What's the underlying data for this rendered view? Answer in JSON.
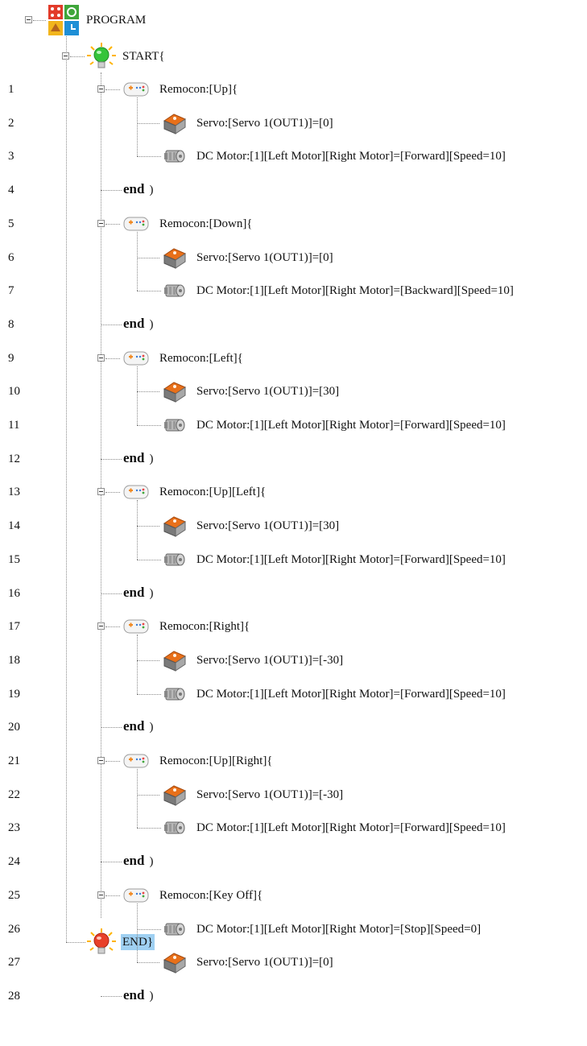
{
  "program_label": "PROGRAM",
  "start_label": "START{",
  "end_label": "END}",
  "end_keyword": "end",
  "end_suffix": ")",
  "nodes": [
    {
      "line": "1",
      "kind": "remocon",
      "text": "Remocon:[Up]{"
    },
    {
      "line": "2",
      "kind": "servo",
      "text": "Servo:[Servo 1(OUT1)]=[0]"
    },
    {
      "line": "3",
      "kind": "motor",
      "text": "DC Motor:[1][Left Motor][Right Motor]=[Forward][Speed=10]"
    },
    {
      "line": "4",
      "kind": "end"
    },
    {
      "line": "5",
      "kind": "remocon",
      "text": "Remocon:[Down]{"
    },
    {
      "line": "6",
      "kind": "servo",
      "text": "Servo:[Servo 1(OUT1)]=[0]"
    },
    {
      "line": "7",
      "kind": "motor",
      "text": "DC Motor:[1][Left Motor][Right Motor]=[Backward][Speed=10]"
    },
    {
      "line": "8",
      "kind": "end"
    },
    {
      "line": "9",
      "kind": "remocon",
      "text": "Remocon:[Left]{"
    },
    {
      "line": "10",
      "kind": "servo",
      "text": "Servo:[Servo 1(OUT1)]=[30]"
    },
    {
      "line": "11",
      "kind": "motor",
      "text": "DC Motor:[1][Left Motor][Right Motor]=[Forward][Speed=10]"
    },
    {
      "line": "12",
      "kind": "end"
    },
    {
      "line": "13",
      "kind": "remocon",
      "text": "Remocon:[Up][Left]{"
    },
    {
      "line": "14",
      "kind": "servo",
      "text": "Servo:[Servo 1(OUT1)]=[30]"
    },
    {
      "line": "15",
      "kind": "motor",
      "text": "DC Motor:[1][Left Motor][Right Motor]=[Forward][Speed=10]"
    },
    {
      "line": "16",
      "kind": "end"
    },
    {
      "line": "17",
      "kind": "remocon",
      "text": "Remocon:[Right]{"
    },
    {
      "line": "18",
      "kind": "servo",
      "text": "Servo:[Servo 1(OUT1)]=[-30]"
    },
    {
      "line": "19",
      "kind": "motor",
      "text": "DC Motor:[1][Left Motor][Right Motor]=[Forward][Speed=10]"
    },
    {
      "line": "20",
      "kind": "end"
    },
    {
      "line": "21",
      "kind": "remocon",
      "text": "Remocon:[Up][Right]{"
    },
    {
      "line": "22",
      "kind": "servo",
      "text": "Servo:[Servo 1(OUT1)]=[-30]"
    },
    {
      "line": "23",
      "kind": "motor",
      "text": "DC Motor:[1][Left Motor][Right Motor]=[Forward][Speed=10]"
    },
    {
      "line": "24",
      "kind": "end"
    },
    {
      "line": "25",
      "kind": "remocon",
      "text": "Remocon:[Key Off]{"
    },
    {
      "line": "26",
      "kind": "motor",
      "text": "DC Motor:[1][Left Motor][Right Motor]=[Stop][Speed=0]"
    },
    {
      "line": "27",
      "kind": "servo",
      "text": "Servo:[Servo 1(OUT1)]=[0]"
    },
    {
      "line": "28",
      "kind": "end"
    }
  ],
  "colors": {
    "selection": "#9fd0f2",
    "tree_line": "#8a8a8a",
    "servo_orange": "#e8701a",
    "bulb_green": "#34c43a",
    "bulb_red": "#e8402a"
  },
  "icons": {
    "program": "program-icon",
    "start": "green-bulb-icon",
    "end": "red-bulb-icon",
    "remocon": "remote-controller-icon",
    "servo": "servo-motor-icon",
    "motor": "dc-motor-icon"
  }
}
